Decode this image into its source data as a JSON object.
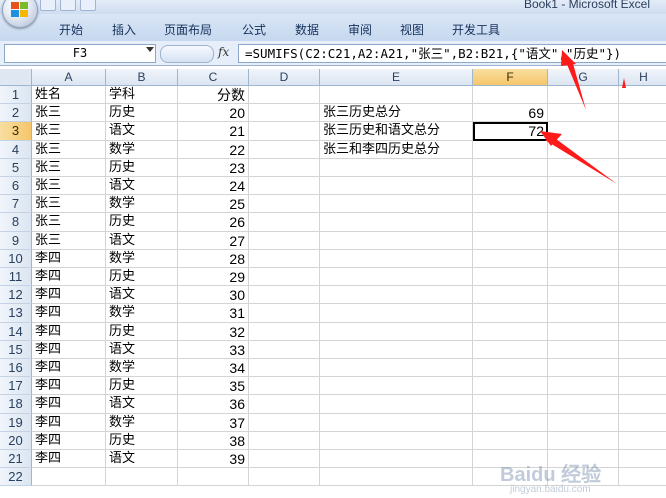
{
  "window": {
    "title": "Book1 - Microsoft Excel"
  },
  "ribbon": {
    "tabs": [
      "开始",
      "插入",
      "页面布局",
      "公式",
      "数据",
      "审阅",
      "视图",
      "开发工具"
    ]
  },
  "formula_bar": {
    "name_box": "F3",
    "fx_label": "fx",
    "formula": "=SUMIFS(C2:C21,A2:A21,\"张三\",B2:B21,{\"语文\",\"历史\"})"
  },
  "sheet": {
    "columns": [
      "A",
      "B",
      "C",
      "D",
      "E",
      "F",
      "G",
      "H"
    ],
    "selected_column": "F",
    "selected_row": 3,
    "rows": [
      {
        "num": 1,
        "a": "姓名",
        "b": "学科",
        "c": "分数",
        "e": "",
        "f": ""
      },
      {
        "num": 2,
        "a": "张三",
        "b": "历史",
        "c": "20",
        "e": "张三历史总分",
        "f": "69"
      },
      {
        "num": 3,
        "a": "张三",
        "b": "语文",
        "c": "21",
        "e": "张三历史和语文总分",
        "f": "72"
      },
      {
        "num": 4,
        "a": "张三",
        "b": "数学",
        "c": "22",
        "e": "张三和李四历史总分",
        "f": ""
      },
      {
        "num": 5,
        "a": "张三",
        "b": "历史",
        "c": "23",
        "e": "",
        "f": ""
      },
      {
        "num": 6,
        "a": "张三",
        "b": "语文",
        "c": "24",
        "e": "",
        "f": ""
      },
      {
        "num": 7,
        "a": "张三",
        "b": "数学",
        "c": "25",
        "e": "",
        "f": ""
      },
      {
        "num": 8,
        "a": "张三",
        "b": "历史",
        "c": "26",
        "e": "",
        "f": ""
      },
      {
        "num": 9,
        "a": "张三",
        "b": "语文",
        "c": "27",
        "e": "",
        "f": ""
      },
      {
        "num": 10,
        "a": "李四",
        "b": "数学",
        "c": "28",
        "e": "",
        "f": ""
      },
      {
        "num": 11,
        "a": "李四",
        "b": "历史",
        "c": "29",
        "e": "",
        "f": ""
      },
      {
        "num": 12,
        "a": "李四",
        "b": "语文",
        "c": "30",
        "e": "",
        "f": ""
      },
      {
        "num": 13,
        "a": "李四",
        "b": "数学",
        "c": "31",
        "e": "",
        "f": ""
      },
      {
        "num": 14,
        "a": "李四",
        "b": "历史",
        "c": "32",
        "e": "",
        "f": ""
      },
      {
        "num": 15,
        "a": "李四",
        "b": "语文",
        "c": "33",
        "e": "",
        "f": ""
      },
      {
        "num": 16,
        "a": "李四",
        "b": "数学",
        "c": "34",
        "e": "",
        "f": ""
      },
      {
        "num": 17,
        "a": "李四",
        "b": "历史",
        "c": "35",
        "e": "",
        "f": ""
      },
      {
        "num": 18,
        "a": "李四",
        "b": "语文",
        "c": "36",
        "e": "",
        "f": ""
      },
      {
        "num": 19,
        "a": "李四",
        "b": "数学",
        "c": "37",
        "e": "",
        "f": ""
      },
      {
        "num": 20,
        "a": "李四",
        "b": "历史",
        "c": "38",
        "e": "",
        "f": ""
      },
      {
        "num": 21,
        "a": "李四",
        "b": "语文",
        "c": "39",
        "e": "",
        "f": ""
      },
      {
        "num": 22,
        "a": "",
        "b": "",
        "c": "",
        "e": "",
        "f": ""
      }
    ]
  },
  "annotations": {
    "arrow_color": "#ff1a1a"
  },
  "watermark": {
    "brand": "Baidu 经验",
    "url": "jingyan.baidu.com"
  }
}
